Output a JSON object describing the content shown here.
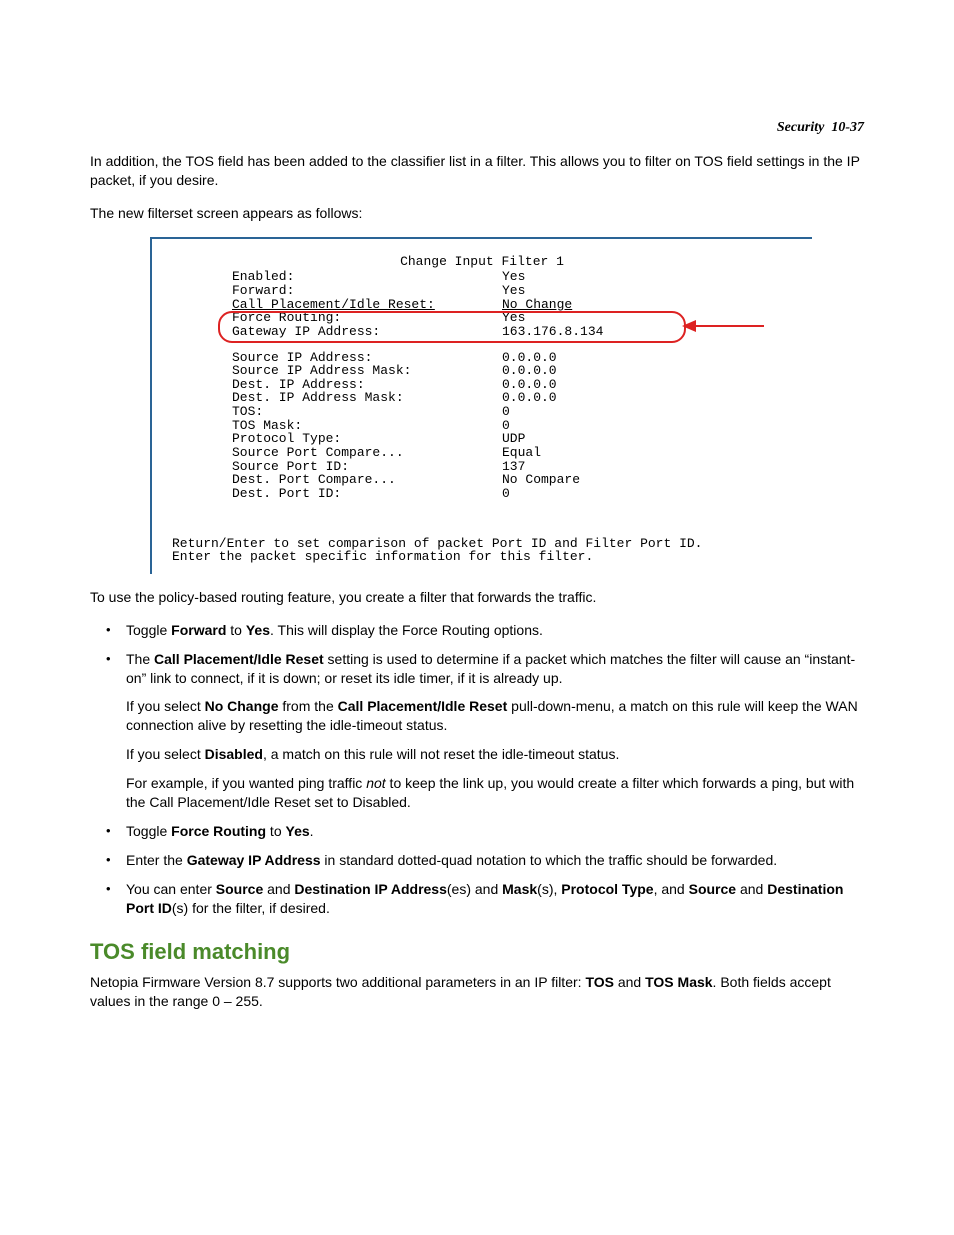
{
  "header": {
    "section": "Security",
    "page": "10-37"
  },
  "intro": {
    "p1": "In addition, the TOS field has been added to the classifier list in a filter. This allows you to filter on TOS field settings in the IP packet, if you desire.",
    "p2": "The new filterset screen appears as follows:"
  },
  "terminal": {
    "title": "Change Input Filter 1",
    "top_rows": [
      {
        "label": "Enabled:",
        "value": "Yes",
        "underline": false
      },
      {
        "label": "Forward:",
        "value": "Yes",
        "underline": false
      },
      {
        "label": "Call Placement/Idle Reset:",
        "value": "No Change",
        "underline": true
      },
      {
        "label": "Force Routing:",
        "value": "Yes",
        "underline": false
      },
      {
        "label": "Gateway IP Address:",
        "value": "163.176.8.134",
        "underline": false
      }
    ],
    "bottom_rows": [
      {
        "label": "Source IP Address:",
        "value": "0.0.0.0"
      },
      {
        "label": "Source IP Address Mask:",
        "value": "0.0.0.0"
      },
      {
        "label": "Dest. IP Address:",
        "value": "0.0.0.0"
      },
      {
        "label": "Dest. IP Address Mask:",
        "value": "0.0.0.0"
      },
      {
        "label": "TOS:",
        "value": "0"
      },
      {
        "label": "TOS Mask:",
        "value": "0"
      },
      {
        "label": "Protocol Type:",
        "value": "UDP"
      },
      {
        "label": "Source Port Compare...",
        "value": "Equal"
      },
      {
        "label": "Source Port ID:",
        "value": "137"
      },
      {
        "label": "Dest. Port Compare...",
        "value": "No Compare"
      },
      {
        "label": "Dest. Port ID:",
        "value": "0"
      }
    ],
    "footer1": "Return/Enter to set comparison of packet Port ID and Filter Port ID.",
    "footer2": "Enter the packet specific information for this filter."
  },
  "after_term": "To use the policy-based routing feature, you create a filter that forwards the traffic.",
  "bullets1": {
    "b1_pre": "Toggle ",
    "b1_bold": "Forward",
    "b1_mid": " to ",
    "b1_bold2": "Yes",
    "b1_post": ". This will display the Force Routing options.",
    "b2_pre": "The ",
    "b2_bold": "Call Placement/Idle Reset",
    "b2_post": " setting is used to determine if a packet which matches the filter will cause an “instant-on” link to connect, if it is down; or reset its idle timer, if it is already up."
  },
  "subs": {
    "s1_pre": "If you select ",
    "s1_b1": "No Change",
    "s1_mid": " from the ",
    "s1_b2": "Call Placement/Idle Reset",
    "s1_post": " pull-down-menu, a match on this rule will keep the WAN connection alive by resetting the idle-timeout status.",
    "s2_pre": "If you select ",
    "s2_b": "Disabled",
    "s2_post": ", a match on this rule will not reset the idle-timeout status.",
    "s3_pre": "For example, if you wanted ping traffic ",
    "s3_i": "not",
    "s3_post": " to keep the link up, you would create a filter which forwards a ping, but with the Call Placement/Idle Reset set to Disabled."
  },
  "bullets2": {
    "b3_pre": "Toggle ",
    "b3_b": "Force Routing",
    "b3_mid": " to ",
    "b3_b2": "Yes",
    "b3_post": ".",
    "b4_pre": "Enter the ",
    "b4_b": "Gateway IP Address",
    "b4_post": " in standard dotted-quad notation to which the traffic should be forwarded.",
    "b5_pre": "You can enter ",
    "b5_b1": "Source",
    "b5_t1": " and ",
    "b5_b2": "Destination IP Address",
    "b5_t2": "(es) and ",
    "b5_b3": "Mask",
    "b5_t3": "(s), ",
    "b5_b4": "Protocol Type",
    "b5_t4": ", and ",
    "b5_b5": "Source",
    "b5_t5": " and ",
    "b5_b6": "Destination Port ID",
    "b5_t6": "(s) for the filter, if desired."
  },
  "section2": {
    "heading": "TOS field matching",
    "p_pre": "Netopia Firmware Version 8.7 supports two additional parameters in an IP filter: ",
    "p_b1": "TOS",
    "p_mid": " and ",
    "p_b2": "TOS Mask",
    "p_post": ". Both fields accept values in the range 0 – 255."
  }
}
